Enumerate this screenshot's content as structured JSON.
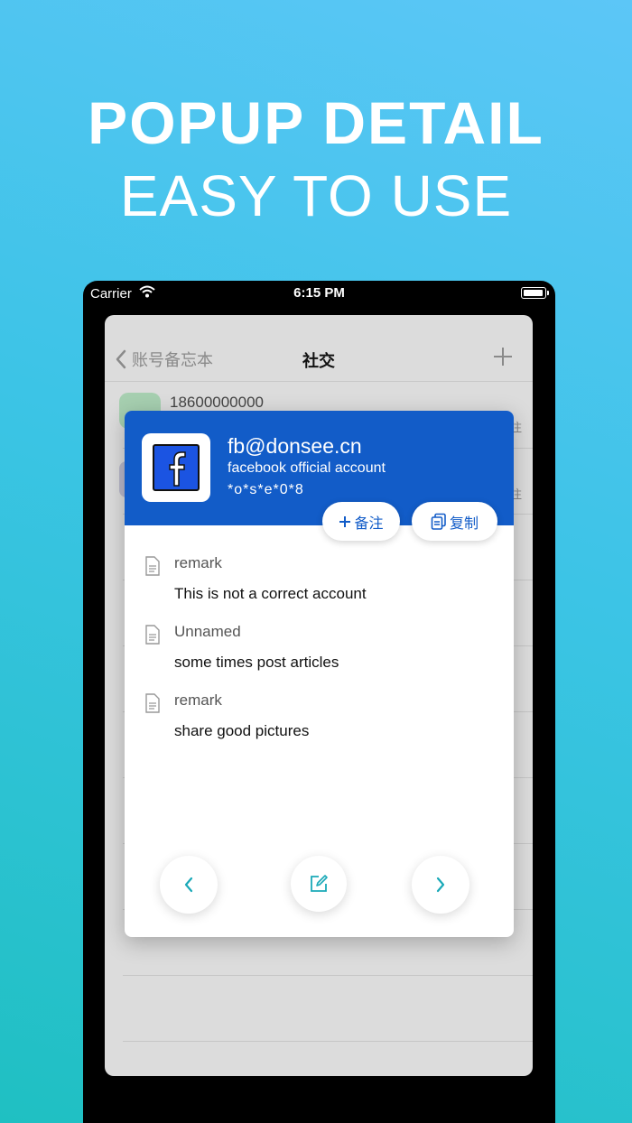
{
  "promo": {
    "title": "POPUP DETAIL",
    "subtitle": "EASY TO USE"
  },
  "status_bar": {
    "carrier": "Carrier",
    "time": "6:15 PM"
  },
  "navbar": {
    "back_label": "账号备忘本",
    "title": "社交"
  },
  "background_list": {
    "first_item_account": "18600000000",
    "tag_fragment": "注"
  },
  "popup": {
    "account": "fb@donsee.cn",
    "description": "facebook official account",
    "masked_password": "*o*s*e*0*8",
    "remark_button": "备注",
    "copy_button": "复制",
    "notes": [
      {
        "label": "remark",
        "text": "This is not a correct account"
      },
      {
        "label": "Unnamed",
        "text": "some times post articles"
      },
      {
        "label": "remark",
        "text": "share good pictures"
      }
    ]
  },
  "colors": {
    "header_blue": "#125cc8",
    "accent_teal": "#1aa9b8"
  },
  "icons": {
    "nav_back": "chevron-left-icon",
    "nav_add": "plus-icon",
    "note": "document-icon",
    "prev": "chevron-left-icon",
    "edit": "edit-icon",
    "next": "chevron-right-icon"
  }
}
